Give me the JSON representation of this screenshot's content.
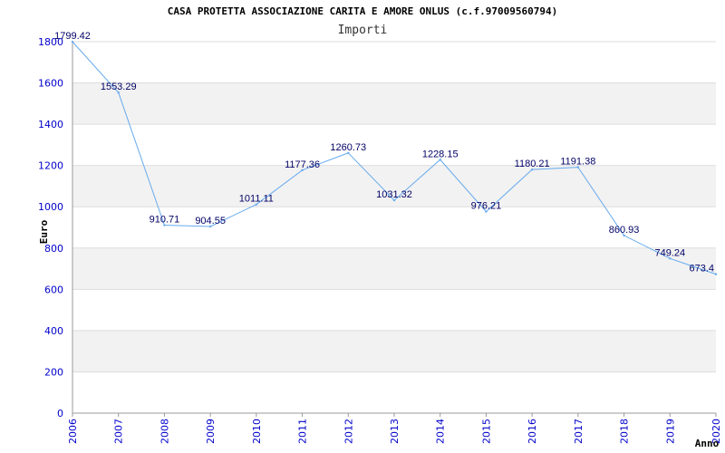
{
  "chart_data": {
    "type": "line",
    "title": "CASA PROTETTA ASSOCIAZIONE CARITA E AMORE ONLUS (c.f.97009560794)",
    "subtitle": "Importi",
    "xlabel": "Anno",
    "ylabel": "Euro",
    "ylim": [
      0,
      1800
    ],
    "yticks": [
      0,
      200,
      400,
      600,
      800,
      1000,
      1200,
      1400,
      1600,
      1800
    ],
    "categories": [
      "2006",
      "2007",
      "2008",
      "2009",
      "2010",
      "2011",
      "2012",
      "2013",
      "2014",
      "2015",
      "2016",
      "2017",
      "2018",
      "2019",
      "2020"
    ],
    "values": [
      1799.42,
      1553.29,
      910.71,
      904.55,
      1011.11,
      1177.36,
      1260.73,
      1031.32,
      1228.15,
      976.21,
      1180.21,
      1191.38,
      860.93,
      749.24,
      673.4
    ],
    "value_labels": [
      "1799.42",
      "1553.29",
      "910.71",
      "904.55",
      "1011.11",
      "1177.36",
      "1260.73",
      "1031.32",
      "1228.15",
      "976.21",
      "1180.21",
      "1191.38",
      "860.93",
      "749.24",
      "673.4"
    ],
    "grid": true,
    "band_color": "#f2f2f2",
    "line_color": "#66aaee",
    "tick_color": "#0000cc"
  }
}
